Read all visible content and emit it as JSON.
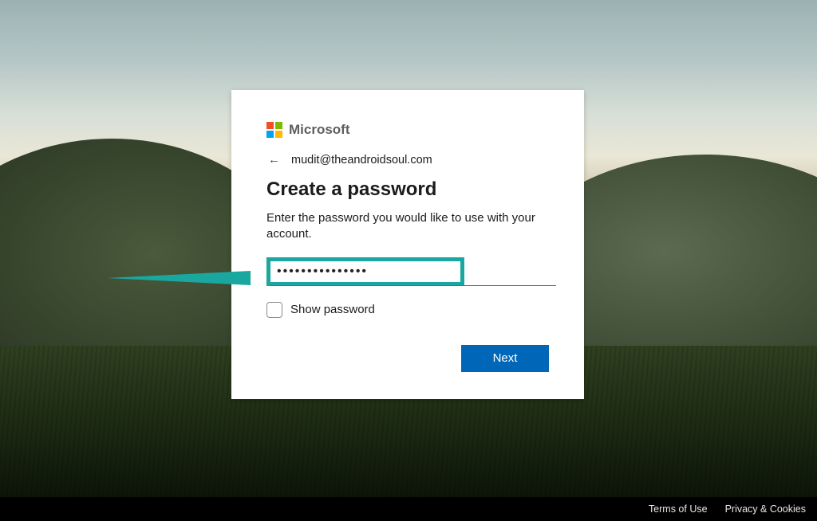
{
  "brand": {
    "name": "Microsoft"
  },
  "identity": {
    "email": "mudit@theandroidsoul.com"
  },
  "heading": "Create a password",
  "subtitle": "Enter the password you would like to use with your account.",
  "password": {
    "masked_value": "•••••••••••••••"
  },
  "show_password": {
    "label": "Show password",
    "checked": false
  },
  "actions": {
    "next_label": "Next"
  },
  "footer": {
    "terms": "Terms of Use",
    "privacy": "Privacy & Cookies"
  }
}
